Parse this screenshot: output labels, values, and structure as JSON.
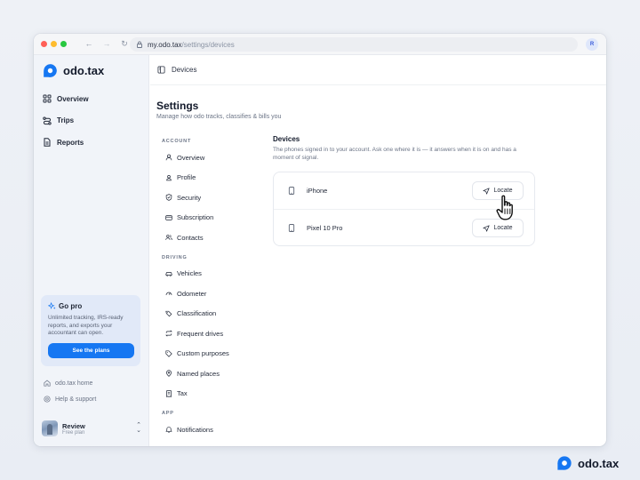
{
  "browser": {
    "url_domain": "my.odo.tax",
    "url_path": "/settings/devices",
    "avatar_initial": "R",
    "traffic_lights": [
      "#ff5f57",
      "#febc2e",
      "#28c840"
    ]
  },
  "brand": {
    "name": "odo.tax",
    "accent": "#1677f2"
  },
  "sidebar": {
    "items": [
      {
        "label": "Overview",
        "icon": "grid-icon"
      },
      {
        "label": "Trips",
        "icon": "route-icon"
      },
      {
        "label": "Reports",
        "icon": "document-icon"
      }
    ],
    "gopro": {
      "title": "Go pro",
      "description": "Unlimited tracking, IRS-ready reports, and exports your accountant can open.",
      "button_label": "See the plans"
    },
    "links": [
      {
        "label": "odo.tax home",
        "icon": "home-icon"
      },
      {
        "label": "Help & support",
        "icon": "help-icon"
      }
    ],
    "user": {
      "name": "Review",
      "plan": "Free plan"
    }
  },
  "topbar": {
    "breadcrumb": "Devices"
  },
  "page": {
    "title": "Settings",
    "subtitle": "Manage how odo tracks, classifies & bills you"
  },
  "settings_nav": {
    "account_label": "ACCOUNT",
    "account": [
      {
        "label": "Overview",
        "icon": "user-icon"
      },
      {
        "label": "Profile",
        "icon": "profile-icon"
      },
      {
        "label": "Security",
        "icon": "shield-icon"
      },
      {
        "label": "Subscription",
        "icon": "card-icon"
      },
      {
        "label": "Contacts",
        "icon": "contacts-icon"
      }
    ],
    "driving_label": "DRIVING",
    "driving": [
      {
        "label": "Vehicles",
        "icon": "car-icon"
      },
      {
        "label": "Odometer",
        "icon": "gauge-icon"
      },
      {
        "label": "Classification",
        "icon": "tags-icon"
      },
      {
        "label": "Frequent drives",
        "icon": "repeat-icon"
      },
      {
        "label": "Custom purposes",
        "icon": "tag-icon"
      },
      {
        "label": "Named places",
        "icon": "pin-icon"
      },
      {
        "label": "Tax",
        "icon": "receipt-icon"
      }
    ],
    "app_label": "APP",
    "app": [
      {
        "label": "Notifications",
        "icon": "bell-icon"
      }
    ]
  },
  "devices": {
    "title": "Devices",
    "description": "The phones signed in to your account. Ask one where it is — it answers when it is on and has a moment of signal.",
    "list": [
      {
        "name": "iPhone",
        "action": "Locate"
      },
      {
        "name": "Pixel 10 Pro",
        "action": "Locate"
      }
    ]
  },
  "footer": {
    "brand": "odo.tax"
  }
}
